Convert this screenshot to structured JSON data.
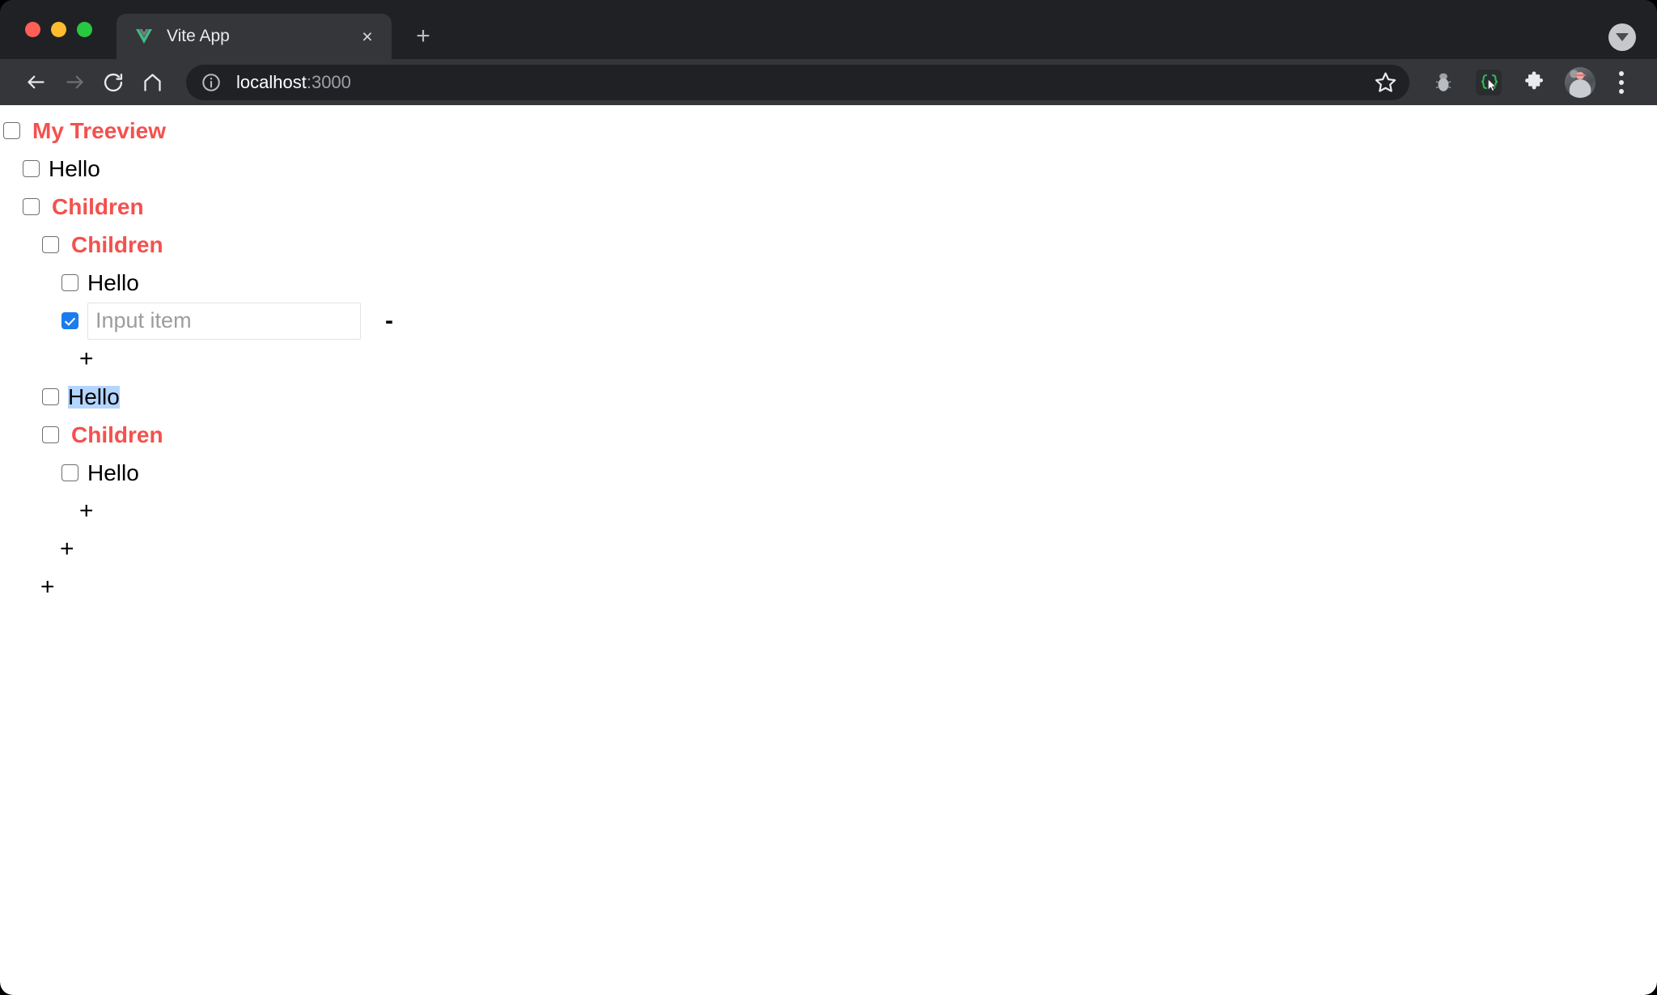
{
  "window": {
    "traffic_lights": [
      "close",
      "minimize",
      "maximize"
    ],
    "colors": {
      "close": "#ff5f57",
      "minimize": "#febc2e",
      "maximize": "#28c840",
      "chrome_bg": "#202124",
      "toolbar_bg": "#35363a",
      "accent_red": "#f4514e",
      "checkbox_blue": "#1b7ced",
      "selection_blue": "#b4d5fe"
    }
  },
  "tabstrip": {
    "tab": {
      "title": "Vite App",
      "favicon": "vite-vue-logo",
      "close_label": "×"
    },
    "new_tab_label": "+",
    "collapse_label": "tab-search-caret"
  },
  "toolbar": {
    "back_label": "back-arrow",
    "forward_label": "forward-arrow",
    "reload_label": "reload",
    "home_label": "home",
    "url": {
      "host": "localhost",
      "port": ":3000",
      "full": "localhost:3000"
    },
    "site_info_label": "site-information",
    "bookmark_label": "bookmark-star",
    "extensions": [
      {
        "name": "bug-extension",
        "label": "bug"
      },
      {
        "name": "selector-extension",
        "label": "{ } cursor"
      },
      {
        "name": "extensions-puzzle",
        "label": "puzzle"
      }
    ],
    "avatar_label": "profile-avatar",
    "menu_label": "chrome-menu"
  },
  "page": {
    "tree": [
      {
        "depth": 0,
        "type": "branch",
        "label": "My Treeview",
        "checked": false
      },
      {
        "depth": 1,
        "type": "leaf",
        "label": "Hello",
        "checked": false
      },
      {
        "depth": 1,
        "type": "branch",
        "label": "Children",
        "checked": false
      },
      {
        "depth": 2,
        "type": "branch",
        "label": "Children",
        "checked": false
      },
      {
        "depth": 3,
        "type": "leaf",
        "label": "Hello",
        "checked": false
      },
      {
        "depth": 3,
        "type": "input",
        "label": "",
        "checked": true,
        "placeholder": "Input item",
        "value": "",
        "remove_label": "-"
      },
      {
        "depth": 3,
        "type": "add",
        "label": "+"
      },
      {
        "depth": 2,
        "type": "leaf",
        "label": "Hello",
        "checked": false,
        "selected": true
      },
      {
        "depth": 2,
        "type": "branch",
        "label": "Children",
        "checked": false
      },
      {
        "depth": 3,
        "type": "leaf",
        "label": "Hello",
        "checked": false
      },
      {
        "depth": 3,
        "type": "add",
        "label": "+"
      },
      {
        "depth": 2,
        "type": "add",
        "label": "+"
      },
      {
        "depth": 1,
        "type": "add",
        "label": "+"
      }
    ]
  }
}
